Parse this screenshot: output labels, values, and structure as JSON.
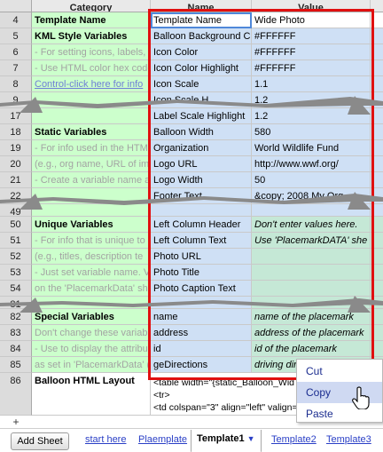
{
  "header": {
    "category": "Category",
    "name": "Name",
    "value": "Value"
  },
  "rows": [
    {
      "n": "4",
      "a": "Template Name",
      "b": "Template Name",
      "c": "Wide Photo"
    },
    {
      "n": "5",
      "a": "KML Style Variables",
      "b": "Balloon Background Co",
      "c": "#FFFFFF"
    },
    {
      "n": "6",
      "a": "- For setting icons, labels,",
      "b": "Icon Color",
      "c": "#FFFFFF"
    },
    {
      "n": "7",
      "a": "- Use HTML color hex code",
      "b": "Icon Color Highlight",
      "c": "#FFFFFF"
    },
    {
      "n": "8",
      "a": "Control-click here for info",
      "b": "Icon Scale",
      "c": "1.1"
    },
    {
      "n": "9",
      "a": "",
      "b": "Icon Scale H",
      "c": "1.2"
    },
    {
      "n": "17",
      "a": "",
      "b": "Label Scale Highlight",
      "c": "1.2"
    },
    {
      "n": "18",
      "a": "Static Variables",
      "b": "Balloon Width",
      "c": "580"
    },
    {
      "n": "19",
      "a": "- For info used in the HTML",
      "b": "Organization",
      "c": "World Wildlife Fund"
    },
    {
      "n": "20",
      "a": "(e.g., org name, URL of ima",
      "b": "Logo URL",
      "c": "http://www.wwf.org/"
    },
    {
      "n": "21",
      "a": "- Create a variable name a",
      "b": "Logo Width",
      "c": "50"
    },
    {
      "n": "22",
      "a": "",
      "b": "Footer Text",
      "c": "&copy; 2008 My Org"
    },
    {
      "n": "49",
      "a": "",
      "b": "",
      "c": ""
    },
    {
      "n": "50",
      "a": "Unique Variables",
      "b": "Left Column Header",
      "c": "Don't enter values here."
    },
    {
      "n": "51",
      "a": "- For info that is unique to",
      "b": "Left Column Text",
      "c": "Use 'PlacemarkDATA' she"
    },
    {
      "n": "52",
      "a": "(e.g., titles, description te",
      "b": "Photo URL",
      "c": ""
    },
    {
      "n": "53",
      "a": "- Just set variable name. V",
      "b": "Photo Title",
      "c": ""
    },
    {
      "n": "54",
      "a": "on the 'PlacemarkData' she",
      "b": "Photo Caption Text",
      "c": ""
    },
    {
      "n": "81",
      "a": "",
      "b": "",
      "c": ""
    },
    {
      "n": "82",
      "a": "Special Variables",
      "b": "name",
      "c": "name of the placemark"
    },
    {
      "n": "83",
      "a": "Don't change these variab",
      "b": "address",
      "c": "address of the placemark"
    },
    {
      "n": "84",
      "a": "- Use to display the attribu",
      "b": "id",
      "c": "id of the placemark"
    },
    {
      "n": "85",
      "a": "as set in 'PlacemarkData' (",
      "b": "geDirections",
      "c": "driving dire"
    }
  ],
  "balloon": {
    "n": "86",
    "label": "Balloon HTML Layout",
    "line1": "<table width=\"{static_Balloon_Wid",
    "line2": "<tr>",
    "line3": "<td colspan=\"3\" align=\"left\" valign="
  },
  "context_menu": {
    "cut": "Cut",
    "copy": "Copy",
    "paste": "Paste"
  },
  "bottom": {
    "plus": "+",
    "add_sheet": "Add Sheet",
    "tabs": [
      "start here",
      "Plaemplate",
      "Template1",
      "Template2",
      "Template3"
    ],
    "active_arrow": "▼"
  },
  "colors": {
    "category_bg": "#ccffcc",
    "name_bg": "#cfe0f5",
    "highlight_red": "#e01010",
    "link": "#2a3fc6"
  }
}
